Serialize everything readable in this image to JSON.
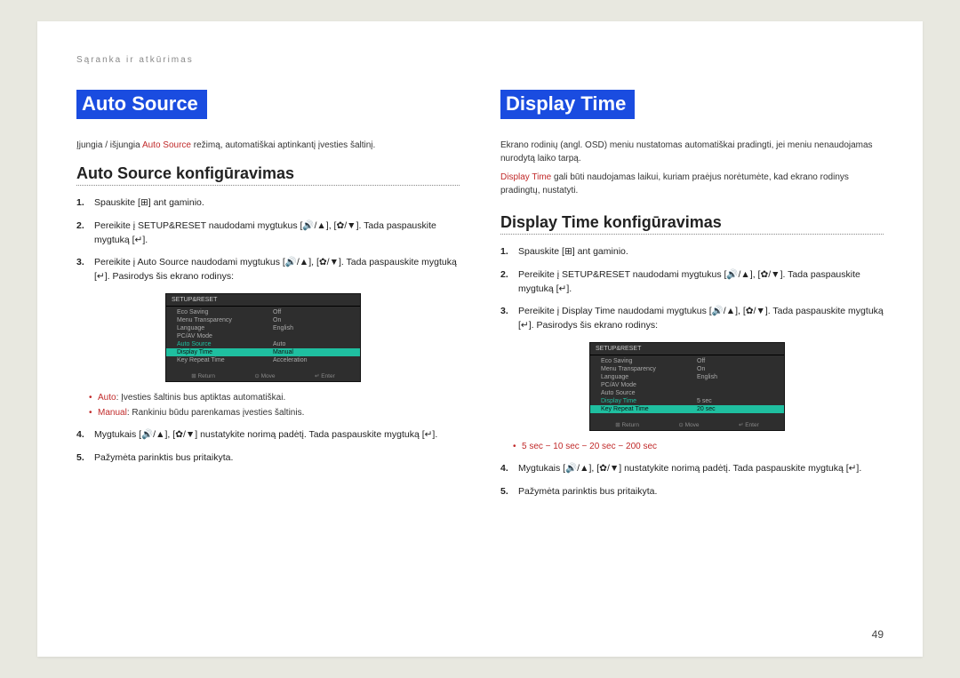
{
  "breadcrumb": "Sąranka ir atkūrimas",
  "page_number": "49",
  "left": {
    "title": "Auto Source",
    "intro_pre": "Įjungia / išjungia ",
    "intro_hl": "Auto Source",
    "intro_post": " režimą, automatiškai aptinkantį įvesties šaltinį.",
    "subtitle": "Auto Source konfigūravimas",
    "steps": {
      "1": {
        "num": "1.",
        "text": "Spauskite [⊞] ant gaminio."
      },
      "2": {
        "num": "2.",
        "pre": "Pereikite į ",
        "hl": "SETUP&RESET",
        "post": " naudodami mygtukus [🔊/▲], [✿/▼]. Tada paspauskite mygtuką [↵]."
      },
      "3": {
        "num": "3.",
        "pre": "Pereikite į ",
        "hl": "Auto Source",
        "post": " naudodami mygtukus [🔊/▲], [✿/▼]. Tada paspauskite mygtuką [↵]. Pasirodys šis ekrano rodinys:"
      },
      "4": {
        "num": "4.",
        "text": "Mygtukais [🔊/▲], [✿/▼] nustatykite norimą padėtį. Tada paspauskite mygtuką [↵]."
      },
      "5": {
        "num": "5.",
        "text": "Pažymėta parinktis bus pritaikyta."
      }
    },
    "bullets": {
      "a": {
        "hl": "Auto",
        "post": ": Įvesties šaltinis bus aptiktas automatiškai."
      },
      "b": {
        "hl": "Manual",
        "post": ": Rankiniu būdu parenkamas įvesties šaltinis."
      }
    },
    "osd": {
      "title": "SETUP&RESET",
      "rows": [
        {
          "lab": "Eco Saving",
          "val": "Off"
        },
        {
          "lab": "Menu Transparency",
          "val": "On"
        },
        {
          "lab": "Language",
          "val": "English"
        },
        {
          "lab": "PC/AV Mode",
          "val": ""
        },
        {
          "lab": "Auto Source",
          "val": "Auto",
          "hi": true
        },
        {
          "lab": "Display Time",
          "val": "Manual",
          "sel": true
        },
        {
          "lab": "Key Repeat Time",
          "val": "Acceleration"
        }
      ],
      "foot": [
        "⊞ Return",
        "⊙ Move",
        "↵ Enter"
      ]
    }
  },
  "right": {
    "title": "Display Time",
    "intro": "Ekrano rodinių (angl. OSD) meniu nustatomas automatiškai pradingti, jei meniu nenaudojamas nurodytą laiko tarpą.",
    "note_hl": "Display Time",
    "note_post": " gali būti naudojamas laikui, kuriam praėjus norėtumėte, kad ekrano rodinys pradingtų, nustatyti.",
    "subtitle": "Display Time konfigūravimas",
    "steps": {
      "1": {
        "num": "1.",
        "text": "Spauskite [⊞] ant gaminio."
      },
      "2": {
        "num": "2.",
        "pre": "Pereikite į ",
        "hl": "SETUP&RESET",
        "post": " naudodami mygtukus [🔊/▲], [✿/▼]. Tada paspauskite mygtuką [↵]."
      },
      "3": {
        "num": "3.",
        "pre": "Pereikite į ",
        "hl": "Display Time",
        "post": " naudodami mygtukus [🔊/▲], [✿/▼]. Tada paspauskite mygtuką [↵]. Pasirodys šis ekrano rodinys:"
      },
      "4": {
        "num": "4.",
        "text": "Mygtukais [🔊/▲], [✿/▼] nustatykite norimą padėtį. Tada paspauskite mygtuką [↵]."
      },
      "5": {
        "num": "5.",
        "text": "Pažymėta parinktis bus pritaikyta."
      }
    },
    "options": "5 sec − 10 sec − 20 sec − 200 sec",
    "osd": {
      "title": "SETUP&RESET",
      "rows": [
        {
          "lab": "Eco Saving",
          "val": "Off"
        },
        {
          "lab": "Menu Transparency",
          "val": "On"
        },
        {
          "lab": "Language",
          "val": "English"
        },
        {
          "lab": "PC/AV Mode",
          "val": ""
        },
        {
          "lab": "Auto Source",
          "val": ""
        },
        {
          "lab": "Display Time",
          "val": "5 sec",
          "hi": true
        },
        {
          "lab": "Key Repeat Time",
          "val": "20 sec",
          "sel": true
        }
      ],
      "foot": [
        "⊞ Return",
        "⊙ Move",
        "↵ Enter"
      ]
    }
  }
}
